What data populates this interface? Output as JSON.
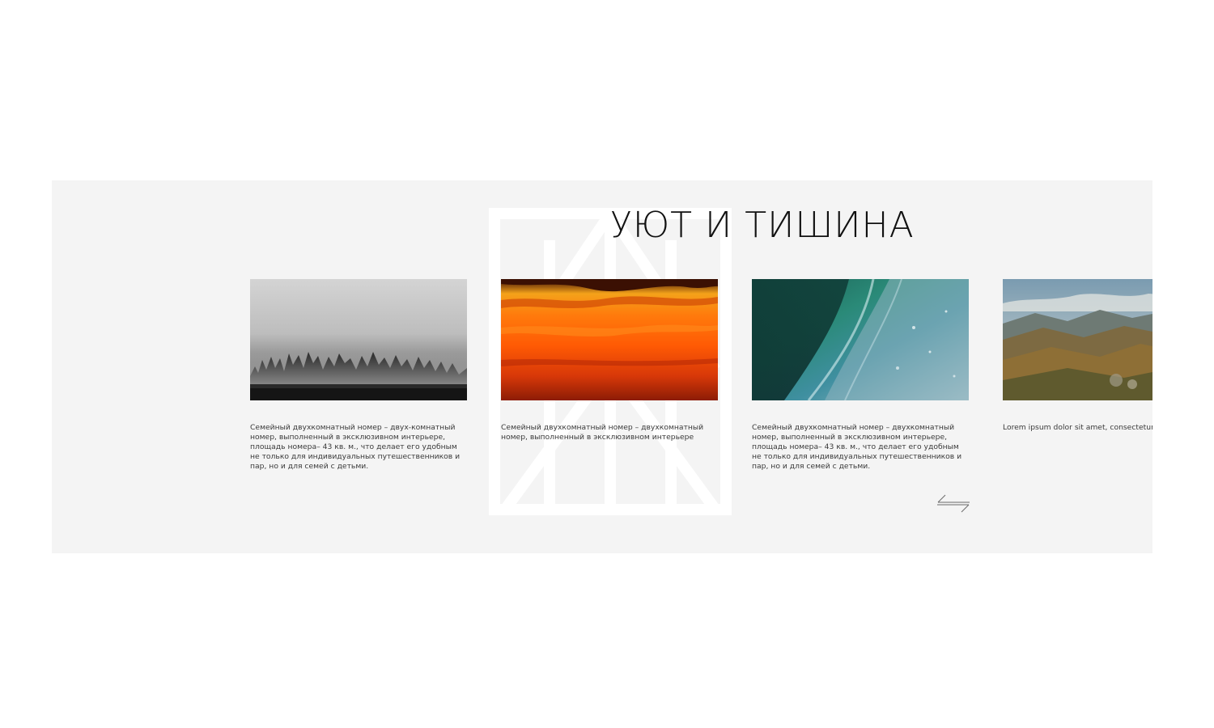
{
  "section": {
    "title": "УЮТ И ТИШИНА",
    "background": "#f4f4f4"
  },
  "rooms": [
    {
      "image": "foggy-forest",
      "description": "Семейный двухкомнатный номер – двух-комнатный номер, выполненный в эксклюзивном интерьере, площадь номера– 43 кв. м., что делает его удобным не только для индивидуальных путешественников и пар, но и для семей с детьми."
    },
    {
      "image": "orange-sunset-sky",
      "description": "Семейный двухкомнатный номер – двухкомнатный номер, выполненный в эксклюзивном интерьере"
    },
    {
      "image": "ocean-wave",
      "description": "Семейный двухкомнатный номер – двухкомнатный номер, выполненный в эксклюзивном интерьере, площадь номера– 43 кв. м., что делает его удобным не только для индивидуальных путешественников и пар, но и для семей с детьми."
    },
    {
      "image": "mountain-landscape",
      "description": "Lorem ipsum dolor sit amet, consectetur a do eiusmod tempor incididunt ut labore e aliqua. Ut enim ad minim veniam, quis no ullamco laboris nisi ut aliquip ex ea comm"
    }
  ],
  "navigation": {
    "prev_icon": "arrow-left-icon",
    "next_icon": "arrow-right-icon"
  },
  "colors": {
    "section_bg": "#f4f4f4",
    "watermark": "#ffffff",
    "text": "#3a3a3a",
    "title": "#111111"
  }
}
